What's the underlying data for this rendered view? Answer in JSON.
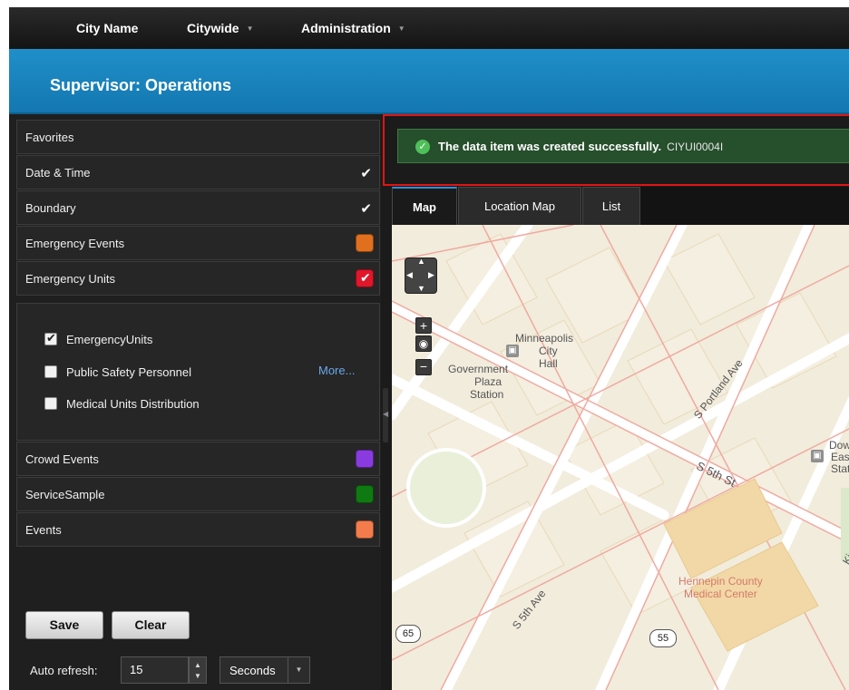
{
  "topnav": {
    "city_name": "City Name",
    "citywide": "Citywide",
    "administration": "Administration"
  },
  "header": {
    "title": "Supervisor: Operations"
  },
  "sidebar": {
    "rows": [
      {
        "label": "Favorites"
      },
      {
        "label": "Date & Time",
        "checked": true
      },
      {
        "label": "Boundary",
        "checked": true
      },
      {
        "label": "Emergency Events",
        "color": "#e0701e"
      },
      {
        "label": "Emergency Units",
        "color": "#e0162b",
        "checked": true
      },
      {
        "label": "Crowd Events",
        "color": "#8a3be0"
      },
      {
        "label": "ServiceSample",
        "color": "#0f7a12"
      },
      {
        "label": "Events",
        "color": "#f47c4c"
      }
    ],
    "emergency_units_options": [
      {
        "label": "EmergencyUnits",
        "checked": true
      },
      {
        "label": "Public Safety Personnel",
        "checked": false
      },
      {
        "label": "Medical Units Distribution",
        "checked": false
      }
    ],
    "more_link": "More...",
    "save_label": "Save",
    "clear_label": "Clear",
    "auto_refresh_label": "Auto refresh:",
    "auto_refresh_value": "15",
    "auto_refresh_unit": "Seconds"
  },
  "message": {
    "text": "The data item was created successfully.",
    "code": "CIYUI0004I"
  },
  "tabs": [
    {
      "label": "Map",
      "active": true
    },
    {
      "label": "Location Map"
    },
    {
      "label": "List"
    }
  ],
  "map": {
    "labels": {
      "city_hall_1": "Minneapolis",
      "city_hall_2": "City",
      "city_hall_3": "Hall",
      "gov_plaza_1": "Government",
      "gov_plaza_2": "Plaza",
      "gov_plaza_3": "Station",
      "portland": "S Portland Ave",
      "fifth_st": "S 5th St",
      "fifth_ave": "S 5th Ave",
      "downtown_1": "Dow",
      "downtown_2": "East",
      "downtown_3": "Stati",
      "hennepin_1": "Hennepin County",
      "hennepin_2": "Medical Center",
      "shield_65": "65",
      "shield_55": "55",
      "kir": "Kir"
    }
  }
}
